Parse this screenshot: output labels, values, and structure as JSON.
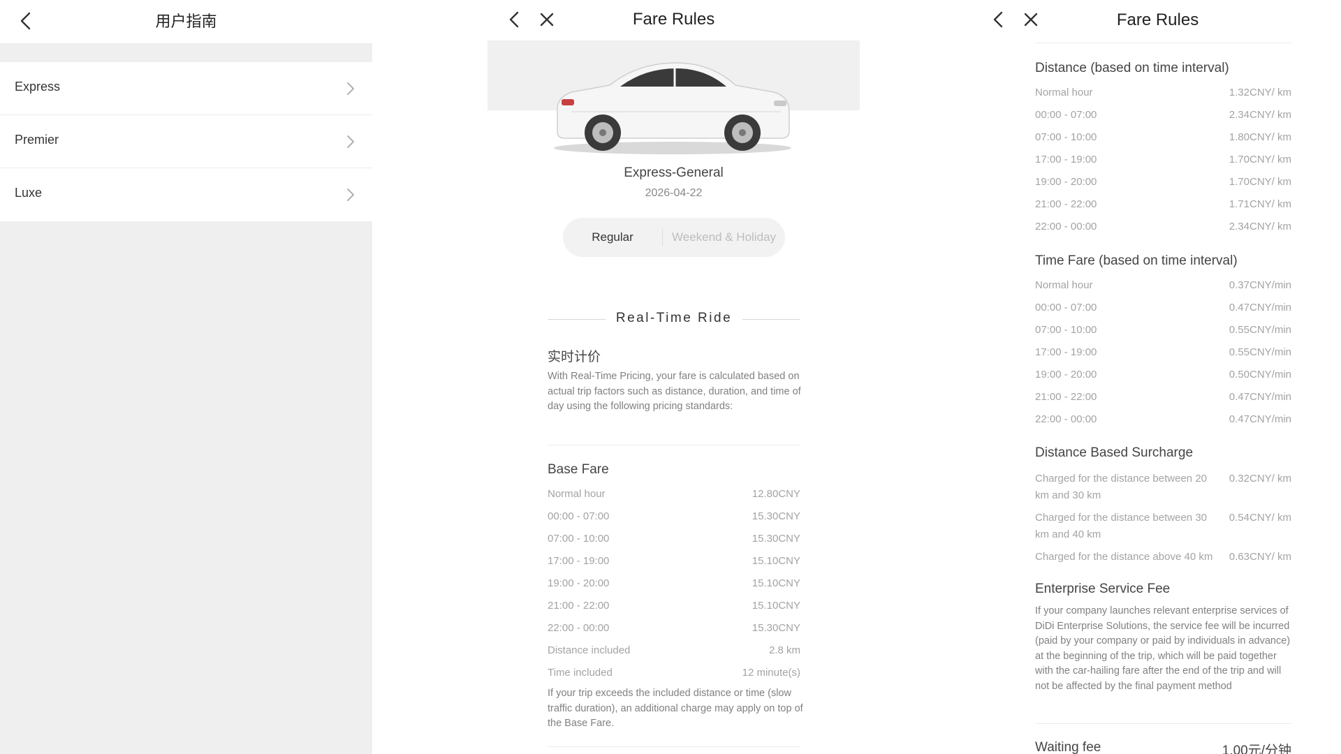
{
  "panel1": {
    "title": "用户指南",
    "items": [
      {
        "label": "Express"
      },
      {
        "label": "Premier"
      },
      {
        "label": "Luxe"
      }
    ]
  },
  "panel2": {
    "title": "Fare Rules",
    "car": {
      "name": "Express-General",
      "date": "2026-04-22"
    },
    "tabs": {
      "regular": "Regular",
      "weekend": "Weekend & Holiday",
      "active": "Regular"
    },
    "section_heading": "Real-Time Ride",
    "realtime": {
      "title": "实时计价",
      "desc": "With Real-Time Pricing, your fare is calculated based on actual trip factors such as distance, duration, and time of day using the following pricing standards:"
    },
    "base_fare": {
      "title": "Base Fare",
      "rows": [
        {
          "k": "Normal hour",
          "v": "12.80CNY"
        },
        {
          "k": "00:00 - 07:00",
          "v": "15.30CNY"
        },
        {
          "k": "07:00 - 10:00",
          "v": "15.30CNY"
        },
        {
          "k": "17:00 - 19:00",
          "v": "15.10CNY"
        },
        {
          "k": "19:00 - 20:00",
          "v": "15.10CNY"
        },
        {
          "k": "21:00 - 22:00",
          "v": "15.10CNY"
        },
        {
          "k": "22:00 - 00:00",
          "v": "15.30CNY"
        },
        {
          "k": "Distance included",
          "v": "2.8 km"
        },
        {
          "k": "Time included",
          "v": "12 minute(s)"
        }
      ],
      "note": "If your trip exceeds the included distance or time (slow traffic duration), an additional charge may apply on top of the Base Fare."
    }
  },
  "panel3": {
    "title": "Fare Rules",
    "distance": {
      "title": "Distance (based on time interval)",
      "rows": [
        {
          "k": "Normal hour",
          "v": "1.32CNY/ km"
        },
        {
          "k": "00:00 - 07:00",
          "v": "2.34CNY/ km"
        },
        {
          "k": "07:00 - 10:00",
          "v": "1.80CNY/ km"
        },
        {
          "k": "17:00 - 19:00",
          "v": "1.70CNY/ km"
        },
        {
          "k": "19:00 - 20:00",
          "v": "1.70CNY/ km"
        },
        {
          "k": "21:00 - 22:00",
          "v": "1.71CNY/ km"
        },
        {
          "k": "22:00 - 00:00",
          "v": "2.34CNY/ km"
        }
      ]
    },
    "time_fare": {
      "title": "Time Fare (based on time interval)",
      "rows": [
        {
          "k": "Normal hour",
          "v": "0.37CNY/min"
        },
        {
          "k": "00:00 - 07:00",
          "v": "0.47CNY/min"
        },
        {
          "k": "07:00 - 10:00",
          "v": "0.55CNY/min"
        },
        {
          "k": "17:00 - 19:00",
          "v": "0.55CNY/min"
        },
        {
          "k": "19:00 - 20:00",
          "v": "0.50CNY/min"
        },
        {
          "k": "21:00 - 22:00",
          "v": "0.47CNY/min"
        },
        {
          "k": "22:00 - 00:00",
          "v": "0.47CNY/min"
        }
      ]
    },
    "surcharge": {
      "title": "Distance Based Surcharge",
      "rows": [
        {
          "k": "Charged for the distance between 20 km and 30 km",
          "v": "0.32CNY/ km"
        },
        {
          "k": "Charged for the distance between 30 km and 40 km",
          "v": "0.54CNY/ km"
        },
        {
          "k": "Charged for the distance above 40 km",
          "v": "0.63CNY/ km"
        }
      ]
    },
    "enterprise": {
      "title": "Enterprise Service Fee",
      "desc": "If your company launches relevant enterprise services of DiDi Enterprise Solutions, the service fee will be incurred (paid by your company or paid by individuals in advance) at the beginning of the trip, which will be paid together with the car-hailing fare after the end of the trip and will not be affected by the final payment method"
    },
    "waiting": {
      "label": "Waiting fee",
      "value": "1.00元/分钟"
    }
  }
}
